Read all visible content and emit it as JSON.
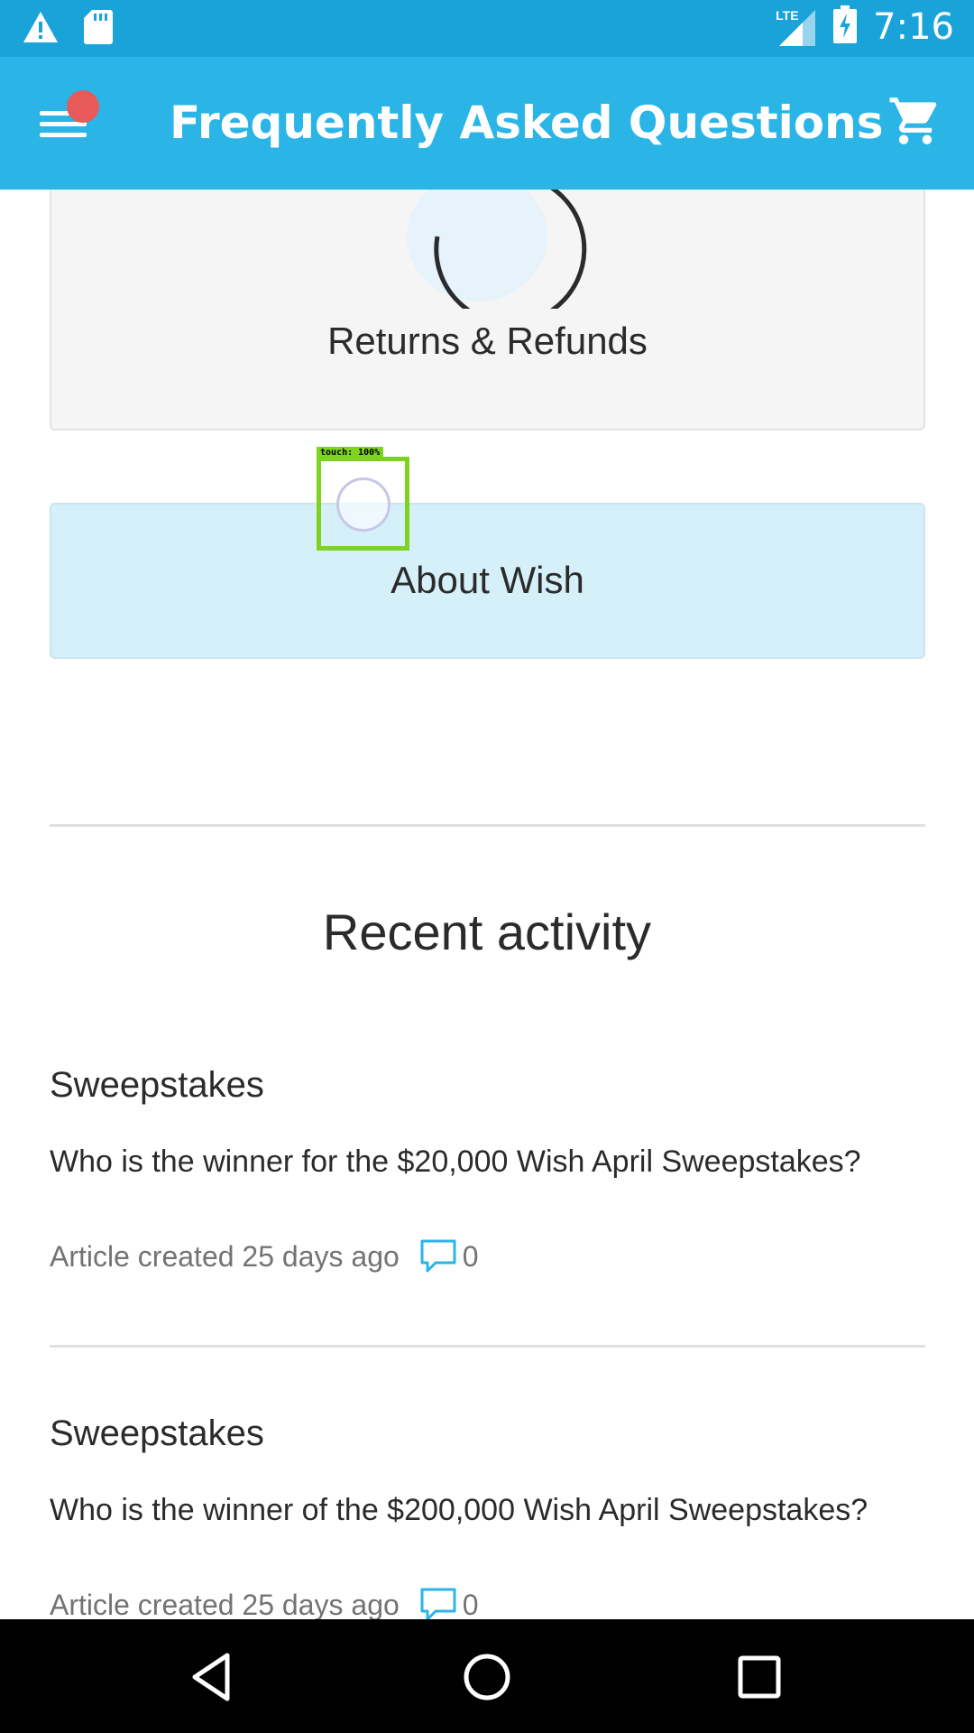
{
  "status_bar": {
    "time": "7:16",
    "network": "LTE",
    "icons": [
      "alert-icon",
      "sd-card-icon",
      "signal-icon",
      "battery-icon"
    ]
  },
  "app_bar": {
    "title": "Frequently Asked Questions",
    "menu_icon": "menu-icon",
    "cart_icon": "cart-icon",
    "notification_badge_color": "#e85a5a"
  },
  "categories": [
    {
      "label": "Returns & Refunds",
      "icon": "spinner-icon"
    },
    {
      "label": "About Wish",
      "highlighted": true
    }
  ],
  "touch_overlay": {
    "label": "touch: 100%"
  },
  "recent_activity": {
    "title": "Recent activity",
    "items": [
      {
        "category": "Sweepstakes",
        "question": "Who is the winner for the $20,000 Wish April Sweepstakes?",
        "meta": "Article created 25 days ago",
        "comments": "0"
      },
      {
        "category": "Sweepstakes",
        "question": "Who is the winner of the $200,000 Wish April Sweepstakes?",
        "meta": "Article created 25 days ago",
        "comments": "0"
      }
    ]
  },
  "nav_bar": {
    "buttons": [
      "back-icon",
      "home-icon",
      "recents-icon"
    ]
  },
  "colors": {
    "primary": "#2bb5e6",
    "status_bar": "#1aa3d8",
    "highlight": "#d6f0f9",
    "touch": "#7ed321"
  }
}
